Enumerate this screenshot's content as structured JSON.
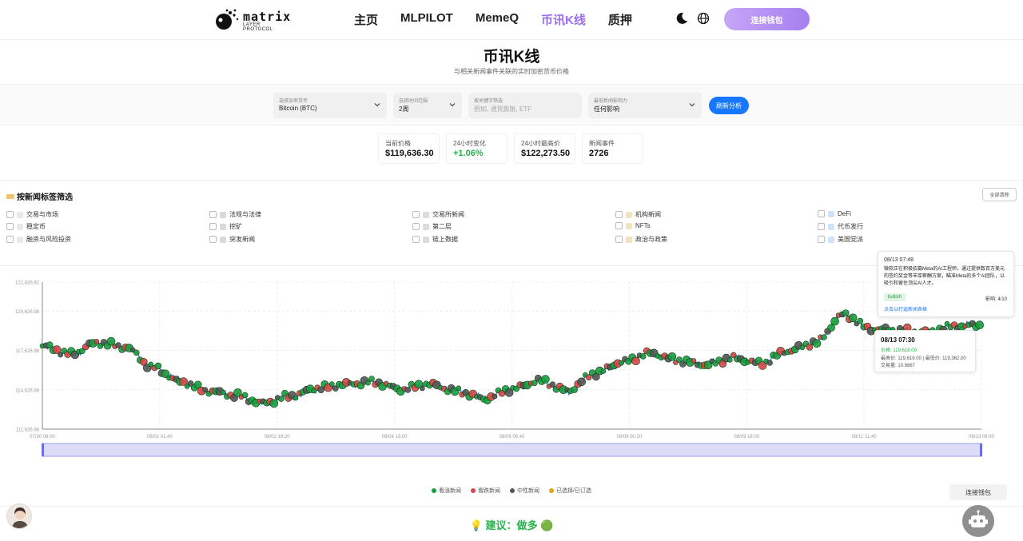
{
  "header": {
    "logo_word": "matrix",
    "logo_sub": "LAYER PROTOCOL",
    "nav": [
      "主页",
      "MLPILOT",
      "MemeQ",
      "币讯K线",
      "质押"
    ],
    "active_nav": 3,
    "wallet_button": "连接钱包"
  },
  "page": {
    "title": "币讯K线",
    "subtitle": "与相关新闻事件关联的实时加密货币价格"
  },
  "filters": {
    "crypto": {
      "label": "选择加密货币",
      "value": "Bitcoin (BTC)"
    },
    "range": {
      "label": "选择时间范围",
      "value": "2周"
    },
    "keyword": {
      "label": "按关键字筛选",
      "placeholder": "例如, 通货膨胀, ETF"
    },
    "impact": {
      "label": "最低新闻影响力",
      "value": "任何影响"
    },
    "refresh": "刷新分析"
  },
  "stats": [
    {
      "label": "当前价格",
      "value": "$119,636.30"
    },
    {
      "label": "24小时变化",
      "value": "+1.06%"
    },
    {
      "label": "24小时最高价",
      "value": "$122,273.50"
    },
    {
      "label": "新闻事件",
      "value": "2726"
    }
  ],
  "tag_filter": {
    "title": "按新闻标签筛选",
    "clear": "全部清除",
    "tags": [
      [
        "交易与市场",
        "法规与法律",
        "交易所新闻",
        "机构新闻",
        "DeFi"
      ],
      [
        "稳定币",
        "挖矿",
        "第二层",
        "NFTs",
        "代币发行"
      ],
      [
        "融资与风险投资",
        "突发新闻",
        "链上数据",
        "政治与政策",
        "美国党派"
      ]
    ]
  },
  "chart_data": {
    "type": "line",
    "series": [
      {
        "name": "BTC",
        "x": [
          "07/30 06:00",
          "07/30 18:00",
          "07/31 06:00",
          "07/31 18:00",
          "08/01 01:40",
          "08/01 12:00",
          "08/02 00:00",
          "08/02 10:00",
          "08/02 19:20",
          "08/03 06:00",
          "08/03 18:00",
          "08/04 08:00",
          "08/04 13:00",
          "08/05 02:00",
          "08/05 14:00",
          "08/06 01:00",
          "08/06 06:40",
          "08/06 18:00",
          "08/07 06:00",
          "08/07 18:00",
          "08/08 06:00",
          "08/08 18:00",
          "08/09 00:20",
          "08/09 12:00",
          "08/10 00:00",
          "08/10 06:00",
          "08/10 12:00",
          "08/11 00:00",
          "08/11 06:00",
          "08/11 11:40",
          "08/11 18:00",
          "08/12 00:00",
          "08/12 12:00",
          "08/13 00:00",
          "08/13 09:00"
        ],
        "values": [
          117900,
          117300,
          118200,
          117900,
          116400,
          115300,
          114600,
          114200,
          113600,
          114100,
          114700,
          115000,
          115200,
          114700,
          115100,
          114600,
          114000,
          114700,
          115300,
          114500,
          115800,
          116700,
          117400,
          116900,
          116600,
          117100,
          116700,
          117600,
          118200,
          120300,
          119200,
          119100,
          119000,
          119500,
          119600
        ]
      }
    ],
    "yticks": [
      "111,626.98",
      "114,626.98",
      "117,626.98",
      "120,626.98",
      "122,835.92"
    ],
    "xticks": [
      "07/30 08:00",
      "08/01 01:40",
      "08/02 19:20",
      "08/04 13:00",
      "08/06 06:40",
      "08/08 00:20",
      "08/09 18:00",
      "08/11 11:40",
      "08/13 09:00"
    ],
    "ylim": [
      111626.98,
      122835.92
    ],
    "grid": true,
    "legend_position": "bottom",
    "legend": [
      "看涨新闻",
      "看跌新闻",
      "中性新闻",
      "已选择/已订选"
    ],
    "colors": {
      "bullish": "#1a9d3d",
      "bearish": "#d94545",
      "neutral": "#555555",
      "selected": "#e8a317",
      "line": "#2b7de0"
    }
  },
  "tooltip_news": {
    "time": "08/13 07:48",
    "text": "微软正在积极招募Meta的AI工程师，通过提供数百万美元的签约奖金等丰厚薪酬方案，瞄准Meta的多个AI团队，以吸引和留住顶尖AI人才。",
    "badge": "bullish",
    "impact": "影响: 4/10",
    "link": "点击以打选新闻表格"
  },
  "tooltip_price": {
    "time": "08/13 07:30",
    "price": "价格: 119,618.00",
    "high_low": "最高价: 119,618.00 | 最低价: 119,362.00",
    "volume": "交易量: 10.9867"
  },
  "bottom": {
    "connect": "连接钱包",
    "suggestion": "💡 建议：做多 🟢"
  }
}
